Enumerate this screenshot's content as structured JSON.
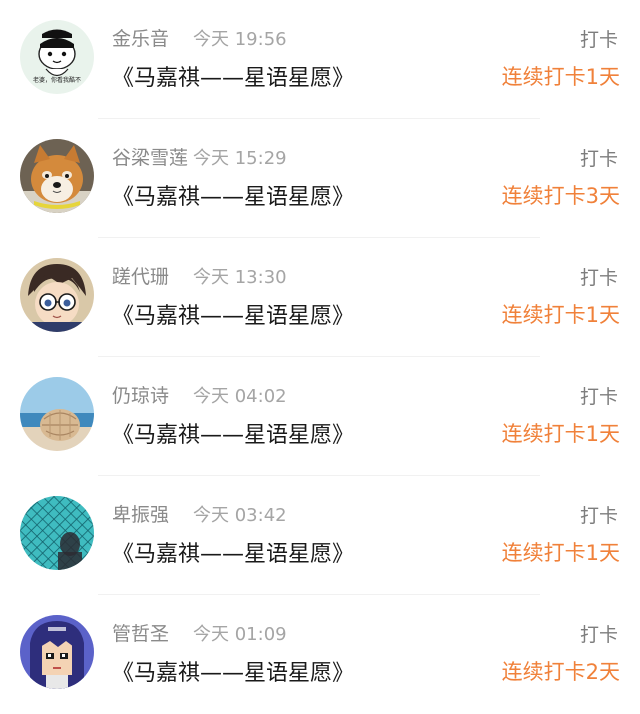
{
  "entries": [
    {
      "name": "金乐音",
      "time": "今天 19:56",
      "action": "打卡",
      "book": "《马嘉祺——星语星愿》",
      "streak": "连续打卡1天",
      "avatar_caption": "老婆，你看我酷不"
    },
    {
      "name": "谷梁雪莲",
      "time": "今天 15:29",
      "action": "打卡",
      "book": "《马嘉祺——星语星愿》",
      "streak": "连续打卡3天"
    },
    {
      "name": "蹉代珊",
      "time": "今天 13:30",
      "action": "打卡",
      "book": "《马嘉祺——星语星愿》",
      "streak": "连续打卡1天"
    },
    {
      "name": "仍琼诗",
      "time": "今天 04:02",
      "action": "打卡",
      "book": "《马嘉祺——星语星愿》",
      "streak": "连续打卡1天"
    },
    {
      "name": "卑振强",
      "time": "今天 03:42",
      "action": "打卡",
      "book": "《马嘉祺——星语星愿》",
      "streak": "连续打卡1天"
    },
    {
      "name": "管哲圣",
      "time": "今天 01:09",
      "action": "打卡",
      "book": "《马嘉祺——星语星愿》",
      "streak": "连续打卡2天"
    }
  ],
  "colors": {
    "streak": "#f0813a",
    "name": "#8a8a8a",
    "time": "#a5a5a5",
    "title": "#1a1a1a"
  },
  "avatars": [
    "cartoon-character-avatar",
    "shiba-dog-avatar",
    "anime-boy-glasses-avatar",
    "seashell-beach-avatar",
    "fence-silhouette-avatar",
    "pixel-anime-girl-avatar"
  ]
}
